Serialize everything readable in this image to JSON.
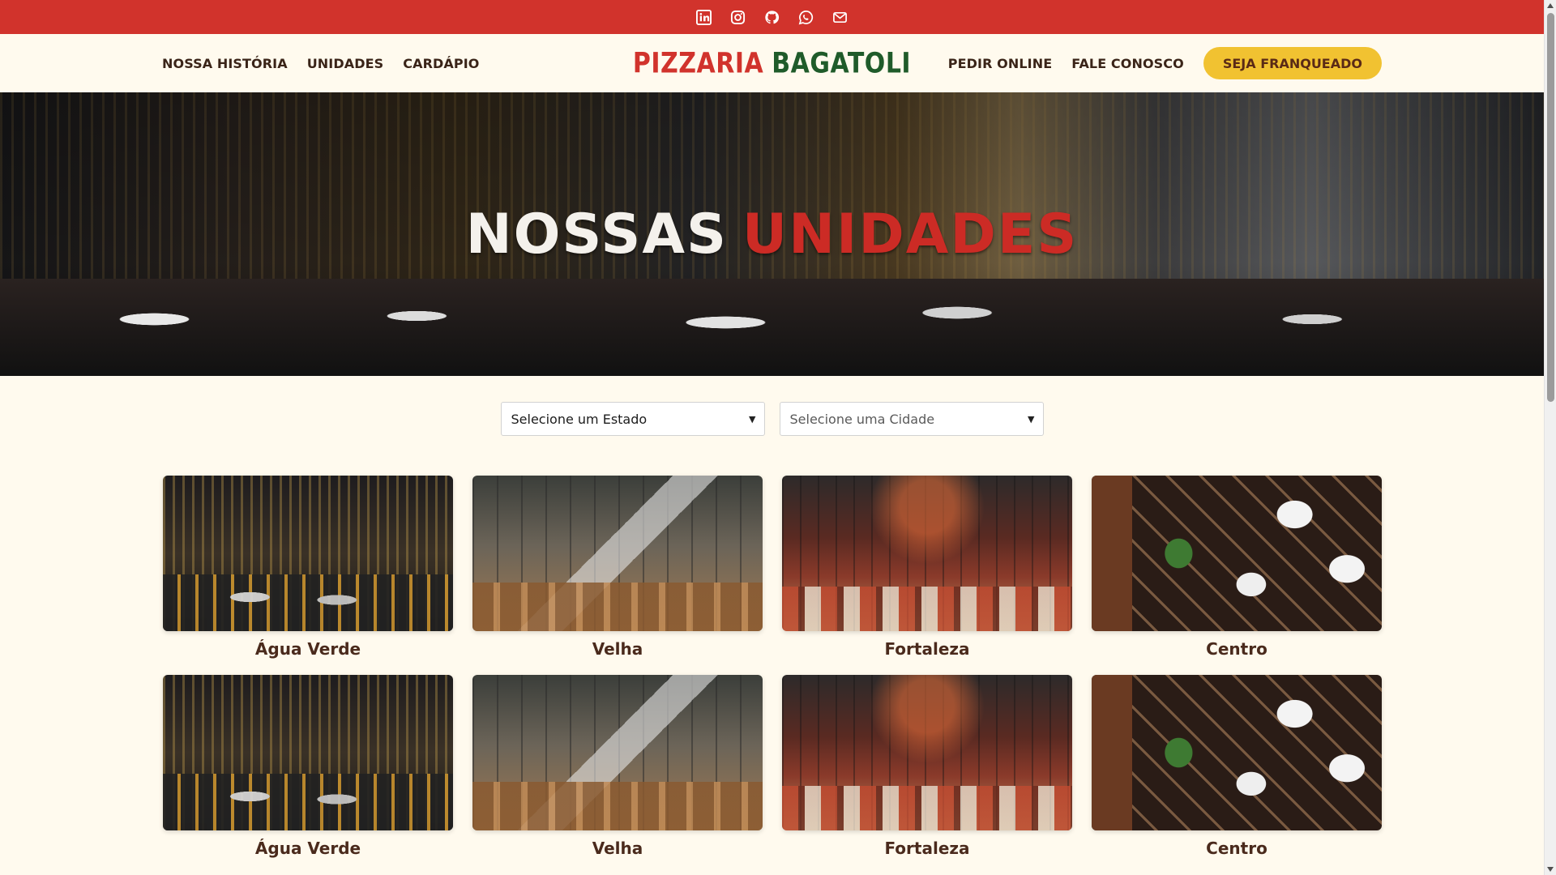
{
  "social": {
    "icons": [
      "linkedin-icon",
      "instagram-icon",
      "github-icon",
      "whatsapp-icon",
      "mail-icon"
    ]
  },
  "nav": {
    "left": [
      "NOSSA HISTÓRIA",
      "UNIDADES",
      "CARDÁPIO"
    ],
    "logo_word1": "PIZZARIA",
    "logo_word2": "BAGATOLI",
    "right": [
      "PEDIR ONLINE",
      "FALE CONOSCO"
    ],
    "cta": "SEJA FRANQUEADO"
  },
  "hero": {
    "title_part1": "NOSSAS",
    "title_part2": "UNIDADES"
  },
  "filters": {
    "state": "Selecione um Estado",
    "city": "Selecione uma Cidade"
  },
  "units": [
    {
      "name": "Água Verde"
    },
    {
      "name": "Velha"
    },
    {
      "name": "Fortaleza"
    },
    {
      "name": "Centro"
    },
    {
      "name": "Água Verde"
    },
    {
      "name": "Velha"
    },
    {
      "name": "Fortaleza"
    },
    {
      "name": "Centro"
    }
  ],
  "colors": {
    "brand_red": "#d1332c",
    "brand_green": "#1f5b2a",
    "cta_yellow": "#f1c231",
    "background": "#fffaee"
  }
}
